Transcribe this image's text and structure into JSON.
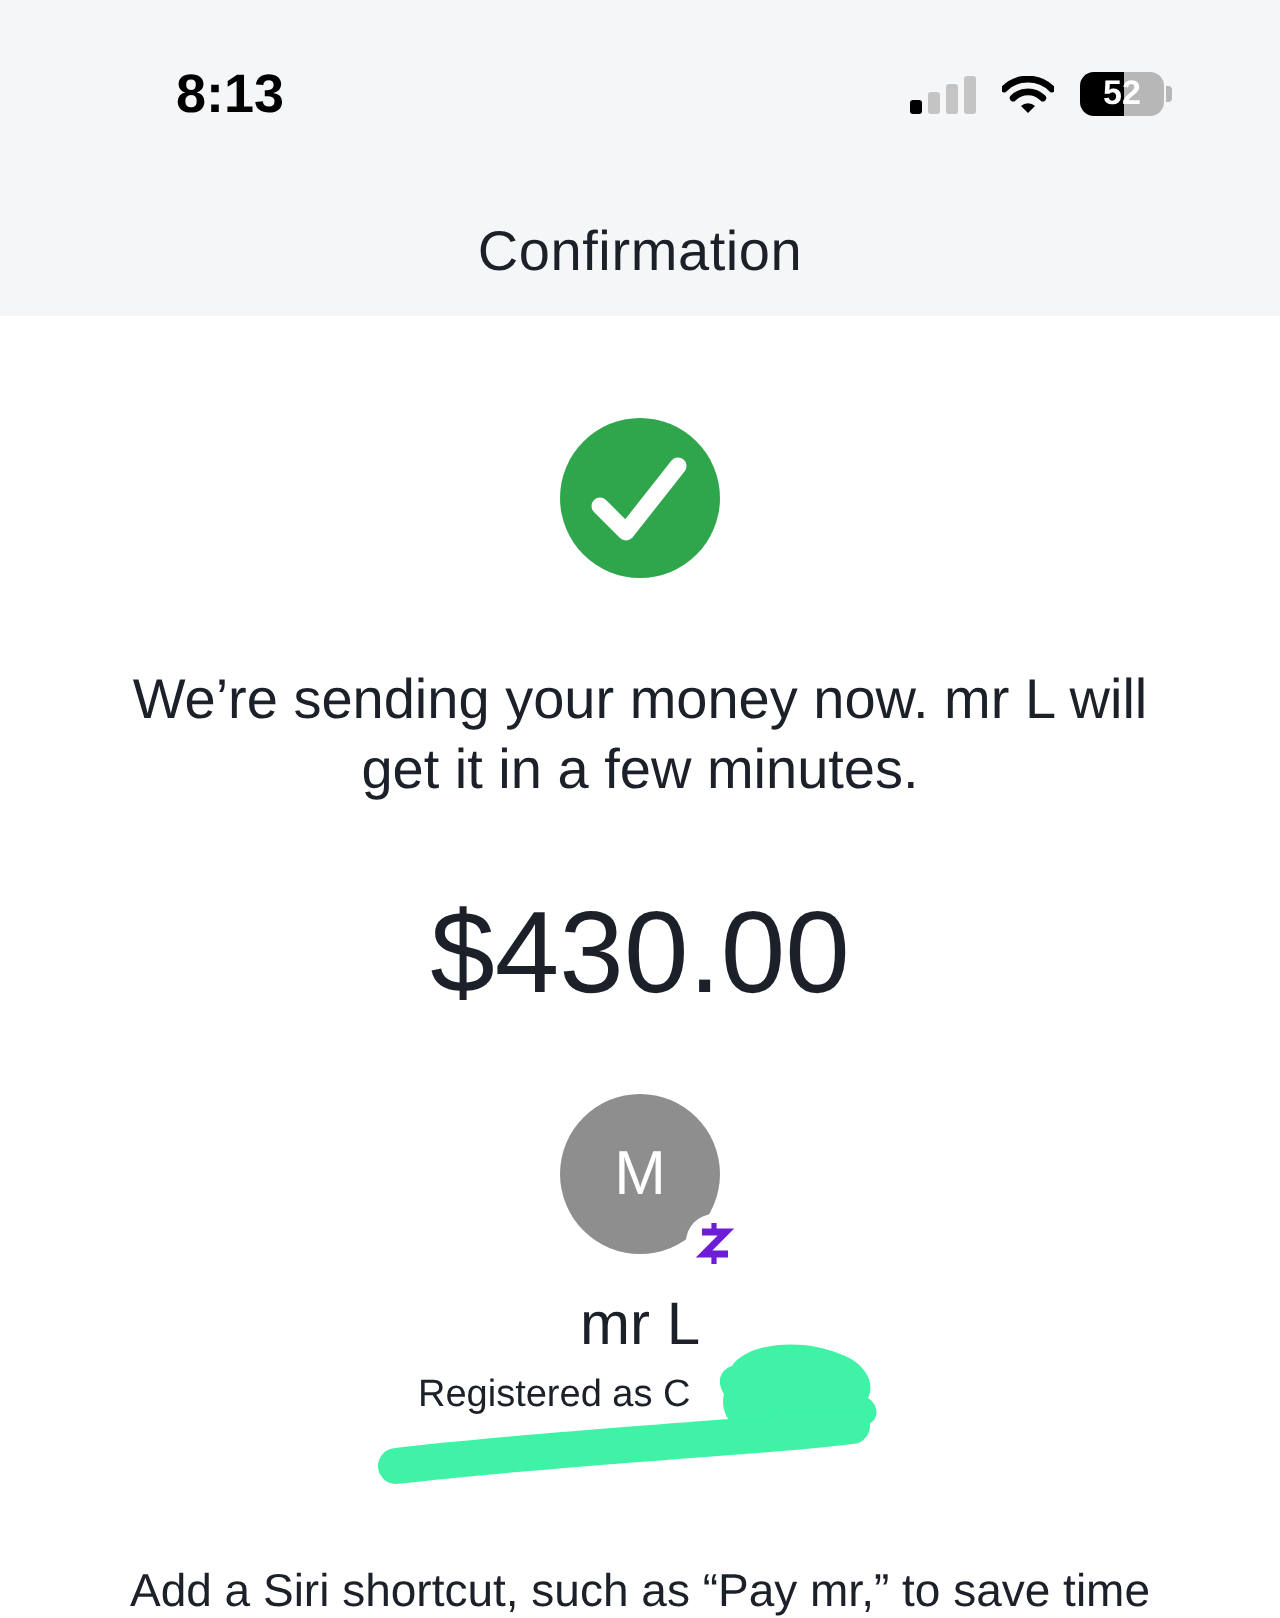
{
  "status_bar": {
    "time": "8:13",
    "battery": "52"
  },
  "header": {
    "title": "Confirmation"
  },
  "confirmation": {
    "message": "We’re sending your money now. mr L will get it in a few minutes.",
    "amount": "$430.00"
  },
  "recipient": {
    "initial": "M",
    "name": "mr L",
    "registered_as": "Registered as C"
  },
  "siri_prompt": "Add a Siri shortcut, such as “Pay mr,” to save time"
}
